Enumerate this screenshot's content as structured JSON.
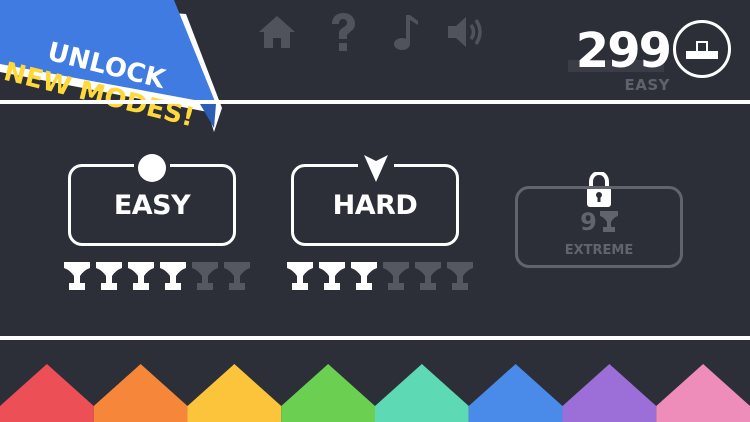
{
  "banner": {
    "line1": "UNLOCK",
    "line2": "NEW MODES!",
    "colors": {
      "ribbon": "#3f7be0",
      "ribbon_dark": "#2d5eb6",
      "line2_text": "#ffd83a"
    }
  },
  "toolbar": {
    "icons": [
      "home-icon",
      "help-icon",
      "music-note-icon",
      "sound-icon"
    ],
    "icon_color": "#50535c"
  },
  "score": {
    "value": "299",
    "mode": "EASY",
    "leaderboard_icon": "podium-icon"
  },
  "modes": [
    {
      "label": "EASY",
      "marker_icon": "circle-icon",
      "trophies_earned": 4,
      "trophies_total": 6
    },
    {
      "label": "HARD",
      "marker_icon": "arrow-down-icon",
      "trophies_earned": 3,
      "trophies_total": 6
    }
  ],
  "locked_mode": {
    "label": "EXTREME",
    "required_trophies": "9",
    "icon": "lock-icon"
  },
  "colors": {
    "background": "#2c2f38",
    "foreground": "#ffffff",
    "muted": "#61646d",
    "trophy_unearned": "#555861",
    "strip": [
      "#ec4f56",
      "#f6863a",
      "#fbc43a",
      "#6bcf52",
      "#5dd9b3",
      "#4a8ae8",
      "#9b6ed8",
      "#ef8dba"
    ]
  }
}
